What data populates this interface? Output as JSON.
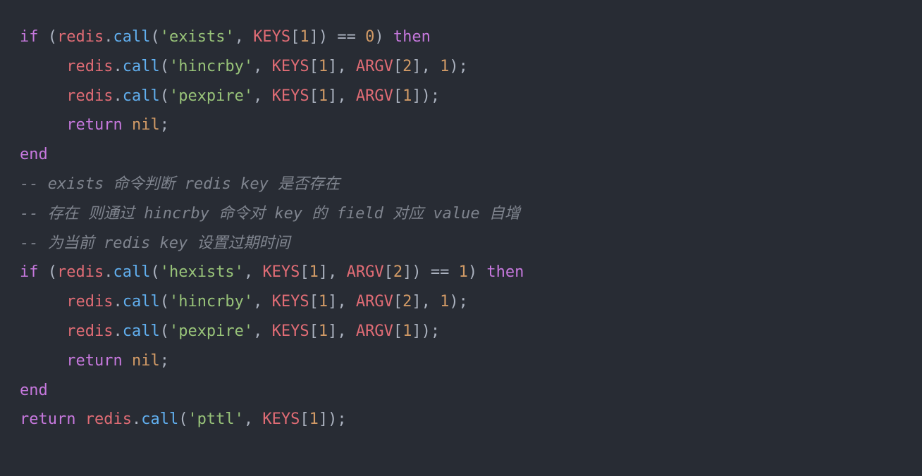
{
  "code": {
    "lines": [
      {
        "indent": 0,
        "tokens": [
          {
            "t": "if ",
            "c": "kw"
          },
          {
            "t": "(",
            "c": "paren"
          },
          {
            "t": "redis",
            "c": "id"
          },
          {
            "t": ".",
            "c": "punct"
          },
          {
            "t": "call",
            "c": "call"
          },
          {
            "t": "(",
            "c": "paren"
          },
          {
            "t": "'exists'",
            "c": "str"
          },
          {
            "t": ", ",
            "c": "punct"
          },
          {
            "t": "KEYS",
            "c": "id"
          },
          {
            "t": "[",
            "c": "punct"
          },
          {
            "t": "1",
            "c": "num"
          },
          {
            "t": "]) == ",
            "c": "punct"
          },
          {
            "t": "0",
            "c": "num"
          },
          {
            "t": ") ",
            "c": "paren"
          },
          {
            "t": "then",
            "c": "kw"
          }
        ]
      },
      {
        "indent": 1,
        "tokens": [
          {
            "t": "redis",
            "c": "id"
          },
          {
            "t": ".",
            "c": "punct"
          },
          {
            "t": "call",
            "c": "call"
          },
          {
            "t": "(",
            "c": "paren"
          },
          {
            "t": "'hincrby'",
            "c": "str"
          },
          {
            "t": ", ",
            "c": "punct"
          },
          {
            "t": "KEYS",
            "c": "id"
          },
          {
            "t": "[",
            "c": "punct"
          },
          {
            "t": "1",
            "c": "num"
          },
          {
            "t": "], ",
            "c": "punct"
          },
          {
            "t": "ARGV",
            "c": "id"
          },
          {
            "t": "[",
            "c": "punct"
          },
          {
            "t": "2",
            "c": "num"
          },
          {
            "t": "], ",
            "c": "punct"
          },
          {
            "t": "1",
            "c": "num"
          },
          {
            "t": ");",
            "c": "punct"
          }
        ]
      },
      {
        "indent": 1,
        "tokens": [
          {
            "t": "redis",
            "c": "id"
          },
          {
            "t": ".",
            "c": "punct"
          },
          {
            "t": "call",
            "c": "call"
          },
          {
            "t": "(",
            "c": "paren"
          },
          {
            "t": "'pexpire'",
            "c": "str"
          },
          {
            "t": ", ",
            "c": "punct"
          },
          {
            "t": "KEYS",
            "c": "id"
          },
          {
            "t": "[",
            "c": "punct"
          },
          {
            "t": "1",
            "c": "num"
          },
          {
            "t": "], ",
            "c": "punct"
          },
          {
            "t": "ARGV",
            "c": "id"
          },
          {
            "t": "[",
            "c": "punct"
          },
          {
            "t": "1",
            "c": "num"
          },
          {
            "t": "]);",
            "c": "punct"
          }
        ]
      },
      {
        "indent": 1,
        "tokens": [
          {
            "t": "return ",
            "c": "kw"
          },
          {
            "t": "nil",
            "c": "const"
          },
          {
            "t": ";",
            "c": "punct"
          }
        ]
      },
      {
        "indent": 0,
        "tokens": [
          {
            "t": "end",
            "c": "kw"
          }
        ]
      },
      {
        "indent": 0,
        "tokens": [
          {
            "t": "-- exists 命令判断 redis key 是否存在",
            "c": "comment"
          }
        ]
      },
      {
        "indent": 0,
        "tokens": [
          {
            "t": "-- 存在 则通过 hincrby 命令对 key 的 field 对应 value 自增",
            "c": "comment"
          }
        ]
      },
      {
        "indent": 0,
        "tokens": [
          {
            "t": "-- 为当前 redis key 设置过期时间",
            "c": "comment"
          }
        ]
      },
      {
        "indent": 0,
        "tokens": [
          {
            "t": "if ",
            "c": "kw"
          },
          {
            "t": "(",
            "c": "paren"
          },
          {
            "t": "redis",
            "c": "id"
          },
          {
            "t": ".",
            "c": "punct"
          },
          {
            "t": "call",
            "c": "call"
          },
          {
            "t": "(",
            "c": "paren"
          },
          {
            "t": "'hexists'",
            "c": "str"
          },
          {
            "t": ", ",
            "c": "punct"
          },
          {
            "t": "KEYS",
            "c": "id"
          },
          {
            "t": "[",
            "c": "punct"
          },
          {
            "t": "1",
            "c": "num"
          },
          {
            "t": "], ",
            "c": "punct"
          },
          {
            "t": "ARGV",
            "c": "id"
          },
          {
            "t": "[",
            "c": "punct"
          },
          {
            "t": "2",
            "c": "num"
          },
          {
            "t": "]) == ",
            "c": "punct"
          },
          {
            "t": "1",
            "c": "num"
          },
          {
            "t": ") ",
            "c": "paren"
          },
          {
            "t": "then",
            "c": "kw"
          }
        ]
      },
      {
        "indent": 1,
        "tokens": [
          {
            "t": "redis",
            "c": "id"
          },
          {
            "t": ".",
            "c": "punct"
          },
          {
            "t": "call",
            "c": "call"
          },
          {
            "t": "(",
            "c": "paren"
          },
          {
            "t": "'hincrby'",
            "c": "str"
          },
          {
            "t": ", ",
            "c": "punct"
          },
          {
            "t": "KEYS",
            "c": "id"
          },
          {
            "t": "[",
            "c": "punct"
          },
          {
            "t": "1",
            "c": "num"
          },
          {
            "t": "], ",
            "c": "punct"
          },
          {
            "t": "ARGV",
            "c": "id"
          },
          {
            "t": "[",
            "c": "punct"
          },
          {
            "t": "2",
            "c": "num"
          },
          {
            "t": "], ",
            "c": "punct"
          },
          {
            "t": "1",
            "c": "num"
          },
          {
            "t": ");",
            "c": "punct"
          }
        ]
      },
      {
        "indent": 1,
        "tokens": [
          {
            "t": "redis",
            "c": "id"
          },
          {
            "t": ".",
            "c": "punct"
          },
          {
            "t": "call",
            "c": "call"
          },
          {
            "t": "(",
            "c": "paren"
          },
          {
            "t": "'pexpire'",
            "c": "str"
          },
          {
            "t": ", ",
            "c": "punct"
          },
          {
            "t": "KEYS",
            "c": "id"
          },
          {
            "t": "[",
            "c": "punct"
          },
          {
            "t": "1",
            "c": "num"
          },
          {
            "t": "], ",
            "c": "punct"
          },
          {
            "t": "ARGV",
            "c": "id"
          },
          {
            "t": "[",
            "c": "punct"
          },
          {
            "t": "1",
            "c": "num"
          },
          {
            "t": "]);",
            "c": "punct"
          }
        ]
      },
      {
        "indent": 1,
        "tokens": [
          {
            "t": "return ",
            "c": "kw"
          },
          {
            "t": "nil",
            "c": "const"
          },
          {
            "t": ";",
            "c": "punct"
          }
        ]
      },
      {
        "indent": 0,
        "tokens": [
          {
            "t": "end",
            "c": "kw"
          }
        ]
      },
      {
        "indent": 0,
        "tokens": [
          {
            "t": "return ",
            "c": "kw"
          },
          {
            "t": "redis",
            "c": "id"
          },
          {
            "t": ".",
            "c": "punct"
          },
          {
            "t": "call",
            "c": "call"
          },
          {
            "t": "(",
            "c": "paren"
          },
          {
            "t": "'pttl'",
            "c": "str"
          },
          {
            "t": ", ",
            "c": "punct"
          },
          {
            "t": "KEYS",
            "c": "id"
          },
          {
            "t": "[",
            "c": "punct"
          },
          {
            "t": "1",
            "c": "num"
          },
          {
            "t": "]);",
            "c": "punct"
          }
        ]
      }
    ],
    "indent_unit": "     "
  }
}
